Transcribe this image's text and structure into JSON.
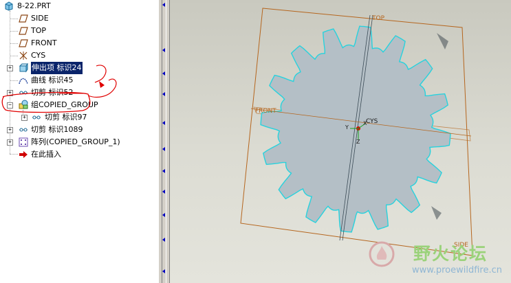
{
  "tree": {
    "root": "8-22.PRT",
    "items": [
      {
        "label": "SIDE"
      },
      {
        "label": "TOP"
      },
      {
        "label": "FRONT"
      },
      {
        "label": "CYS"
      },
      {
        "label": "伸出项 标识24"
      },
      {
        "label": "曲线 标识45"
      },
      {
        "label": "切剪 标识52"
      },
      {
        "label": "组COPIED_GROUP"
      },
      {
        "label": "切剪 标识97"
      },
      {
        "label": "切剪 标识1089"
      },
      {
        "label": "阵列(COPIED_GROUP_1)"
      },
      {
        "label": "在此插入"
      }
    ]
  },
  "viewport": {
    "datum_labels": {
      "top": "TOP",
      "front": "FRONT",
      "side": "SIDE",
      "cys": "CYS",
      "x": "X",
      "y": "Y",
      "z": "Z"
    }
  },
  "watermark": {
    "title": "野火论坛",
    "url": "www.proewildfire.cn"
  },
  "colors": {
    "selection": "#0a246a",
    "gear_fill": "#b4bfc6",
    "edge_highlight": "#27d2dd",
    "datum": "#b5651d",
    "annotation": "#e00000"
  }
}
